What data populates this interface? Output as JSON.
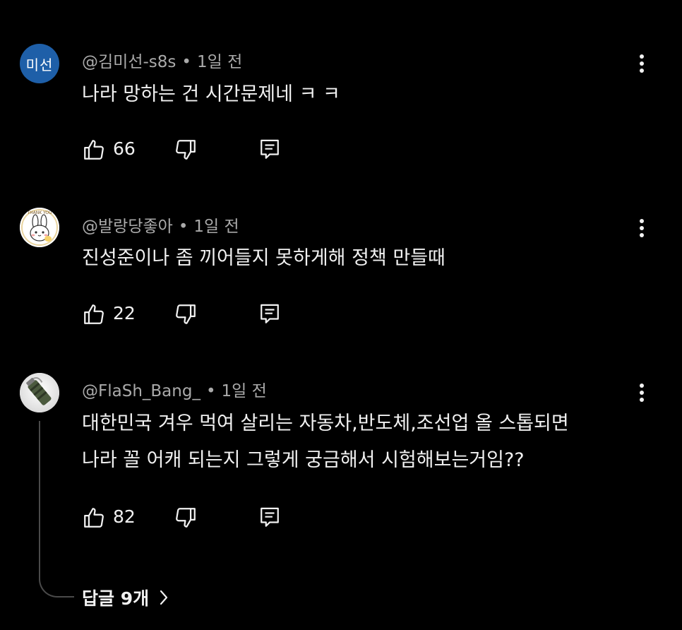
{
  "comments": [
    {
      "author": "@김미선-s8s",
      "time": "1일 전",
      "separator": "•",
      "avatar_initials": "미선",
      "avatar_color": "#1e5fa8",
      "text_lines": [
        "나라 망하는 건 시간문제네 ㅋ ㅋ"
      ],
      "likes": "66"
    },
    {
      "author": "@발랑당좋아",
      "time": "1일 전",
      "separator": "•",
      "avatar_image": "bunny-thank-you-avatar",
      "avatar_text": "THANK YOU",
      "text_lines": [
        "진성준이나 좀 끼어들지 못하게해 정책 만들때"
      ],
      "likes": "22"
    },
    {
      "author": "@FlaSh_Bang_",
      "time": "1일 전",
      "separator": "•",
      "avatar_image": "flashbang-grenade-avatar",
      "text_lines": [
        "대한민국 겨우 먹여 살리는 자동차,반도체,조선업 올 스톱되면",
        "나라 꼴 어캐 되는지 그렇게 궁금해서 시험해보는거임??"
      ],
      "likes": "82",
      "replies_label": "답글 9개"
    }
  ],
  "icons": {
    "like": "thumbs-up-icon",
    "dislike": "thumbs-down-icon",
    "reply": "comment-reply-icon",
    "more": "more-vert-icon",
    "chevron": "chevron-right-icon"
  },
  "colors": {
    "background": "#000000",
    "text": "#f1f1f1",
    "meta_text": "#aaaaaa"
  }
}
